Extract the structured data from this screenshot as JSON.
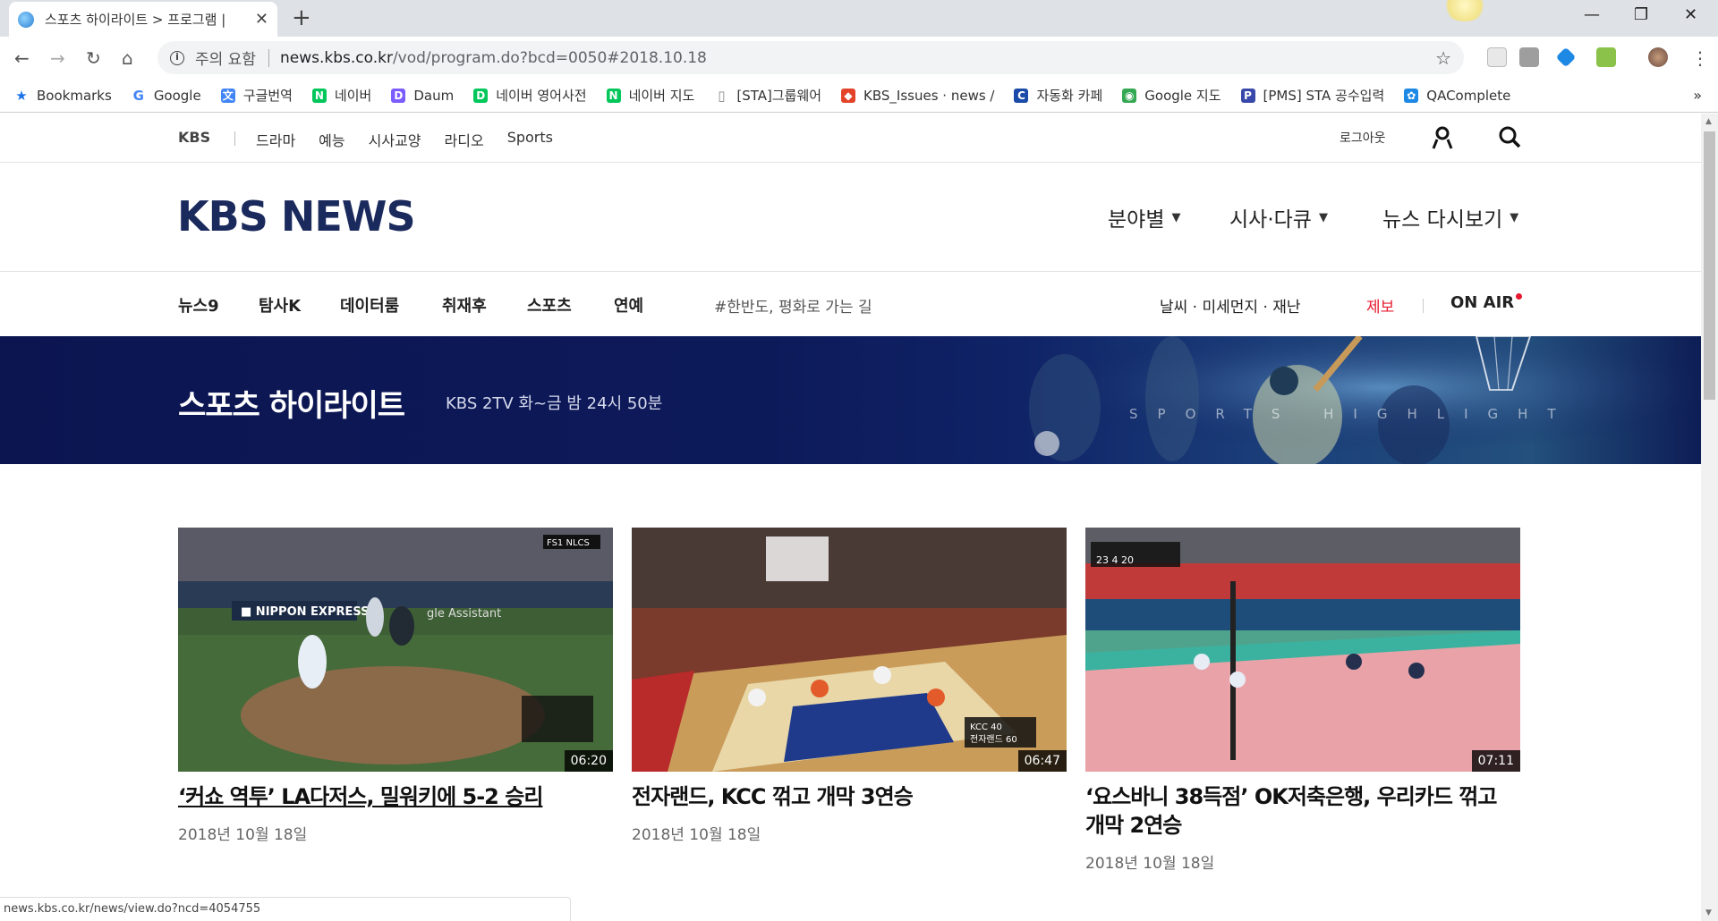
{
  "browser": {
    "tab_title": "스포츠 하이라이트 > 프로그램 |",
    "url_warning": "주의 요함",
    "url_host": "news.kbs.co.kr",
    "url_path": "/vod/program.do?bcd=0050#2018.10.18",
    "bookmarks": [
      {
        "label": "Bookmarks",
        "icon": "star-icon",
        "color": "#1a73e8"
      },
      {
        "label": "Google",
        "icon": "google-icon",
        "color": "#4285f4"
      },
      {
        "label": "구글번역",
        "icon": "translate-icon",
        "color": "#4285f4"
      },
      {
        "label": "네이버",
        "icon": "naver-icon",
        "color": "#03c75a"
      },
      {
        "label": "Daum",
        "icon": "daum-icon",
        "color": "#7a5cff"
      },
      {
        "label": "네이버 영어사전",
        "icon": "dict-icon",
        "color": "#03c75a"
      },
      {
        "label": "네이버 지도",
        "icon": "naver-icon",
        "color": "#03c75a"
      },
      {
        "label": "[STA]그룹웨어",
        "icon": "page-icon",
        "color": "#888888"
      },
      {
        "label": "KBS_Issues · news /",
        "icon": "gitlab-icon",
        "color": "#e24329"
      },
      {
        "label": "자동화 카페",
        "icon": "cafe-icon",
        "color": "#1a4ba8"
      },
      {
        "label": "Google 지도",
        "icon": "maps-icon",
        "color": "#34a853"
      },
      {
        "label": "[PMS] STA 공수입력",
        "icon": "pms-icon",
        "color": "#3949ab"
      },
      {
        "label": "QAComplete",
        "icon": "qa-icon",
        "color": "#1e88e5"
      }
    ],
    "more": "»"
  },
  "top_nav": {
    "brand": "KBS",
    "links": [
      "드라마",
      "예능",
      "시사교양",
      "라디오",
      "Sports"
    ],
    "logout": "로그아웃"
  },
  "header": {
    "logo": "KBS NEWS",
    "menus": [
      "분야별",
      "시사·다큐",
      "뉴스 다시보기"
    ]
  },
  "category_nav": {
    "items": [
      "뉴스9",
      "탐사K",
      "데이터룸",
      "취재후",
      "스포츠",
      "연예"
    ],
    "hashtag": "#한반도, 평화로 가는 길",
    "weather": "날씨 · 미세먼지 · 재난",
    "report": "제보",
    "on_air": "ON AIR",
    "report_color": "#e5182e"
  },
  "banner": {
    "title": "스포츠 하이라이트",
    "subtitle": "KBS 2TV 화~금 밤 24시 50분",
    "watermark": "SPORTS HIGHLIGHT"
  },
  "videos": [
    {
      "title": "‘커쇼 역투’ LA다저스, 밀워키에 5-2 승리",
      "date": "2018년 10월 18일",
      "duration": "06:20"
    },
    {
      "title": "전자랜드, KCC 꺾고 개막 3연승",
      "date": "2018년 10월 18일",
      "duration": "06:47"
    },
    {
      "title": "‘요스바니 38득점’ OK저축은행, 우리카드 꺾고 개막 2연승",
      "date": "2018년 10월 18일",
      "duration": "07:11"
    }
  ],
  "status_bar": "news.kbs.co.kr/news/view.do?ncd=4054755"
}
